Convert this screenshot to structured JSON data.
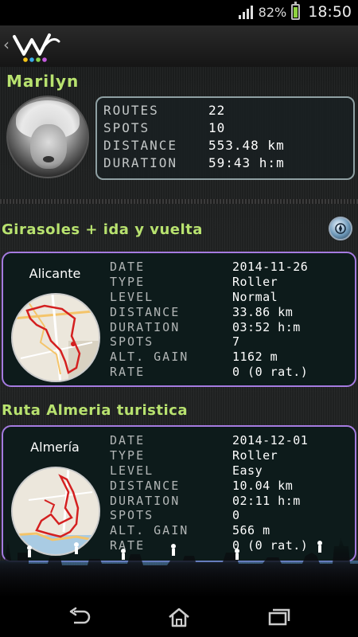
{
  "status_bar": {
    "battery": "82%",
    "time": "18:50",
    "icons": [
      "signal-icon",
      "battery-icon"
    ]
  },
  "action_bar": {
    "back_icon": "chevron-left-icon",
    "logo": "app-logo"
  },
  "profile": {
    "name": "Marilyn",
    "stats": [
      {
        "label": "ROUTES",
        "value": "22"
      },
      {
        "label": "SPOTS",
        "value": "10"
      },
      {
        "label": "DISTANCE",
        "value": "553.48 km"
      },
      {
        "label": "DURATION",
        "value": "59:43 h:m"
      }
    ]
  },
  "routes": [
    {
      "title": "Girasoles + ida y vuelta",
      "city": "Alicante",
      "details": [
        {
          "label": "DATE",
          "value": "2014-11-26"
        },
        {
          "label": "TYPE",
          "value": "Roller"
        },
        {
          "label": "LEVEL",
          "value": "Normal"
        },
        {
          "label": "DISTANCE",
          "value": "33.86 km"
        },
        {
          "label": "DURATION",
          "value": "03:52 h:m"
        },
        {
          "label": "SPOTS",
          "value": "7"
        },
        {
          "label": "ALT. GAIN",
          "value": "1162 m"
        },
        {
          "label": "RATE",
          "value": "0 (0 rat.)"
        }
      ]
    },
    {
      "title": "Ruta Almeria turistica",
      "city": "Almería",
      "details": [
        {
          "label": "DATE",
          "value": "2014-12-01"
        },
        {
          "label": "TYPE",
          "value": "Roller"
        },
        {
          "label": "LEVEL",
          "value": "Easy"
        },
        {
          "label": "DISTANCE",
          "value": "10.04 km"
        },
        {
          "label": "DURATION",
          "value": "02:11 h:m"
        },
        {
          "label": "SPOTS",
          "value": "0"
        },
        {
          "label": "ALT. GAIN",
          "value": "566 m"
        },
        {
          "label": "RATE",
          "value": "0 (0 rat.)"
        }
      ]
    }
  ],
  "colors": {
    "accent_green": "#b8e26f",
    "card_border": "#a57be0",
    "card_bg": "#0d1b1b"
  },
  "nav_bar": {
    "icons": [
      "back-icon",
      "home-icon",
      "recent-apps-icon"
    ]
  }
}
